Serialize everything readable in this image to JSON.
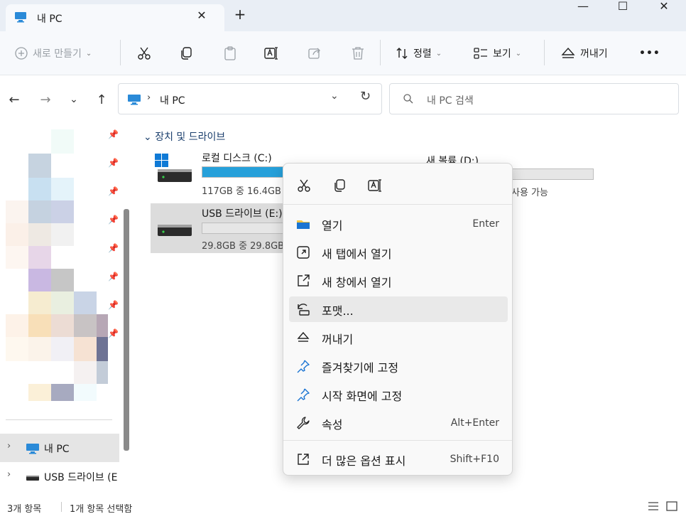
{
  "window": {
    "tab_title": "내 PC",
    "tab_close": "✕",
    "new_tab": "+",
    "minimize": "—",
    "maximize": "☐",
    "close": "✕"
  },
  "toolbar": {
    "new_label": "새로 만들기",
    "sort_label": "정렬",
    "view_label": "보기",
    "eject_label": "꺼내기",
    "more": "•••"
  },
  "address": {
    "crumb_separator": "›",
    "crumb": "내 PC",
    "dropdown": "⌄",
    "refresh": "↻",
    "search_placeholder": "내 PC 검색"
  },
  "nav": {
    "back": "←",
    "forward": "→",
    "recent": "⌄",
    "up": "↑",
    "items": [
      {
        "label": "내 PC",
        "expander": "›"
      },
      {
        "label": "USB 드라이브 (E",
        "expander": "›"
      }
    ]
  },
  "content": {
    "group_header": "장치 및 드라이브",
    "group_chevron": "⌄",
    "drives": [
      {
        "name": "로컬 디스크 (C:)",
        "space": "117GB 중 16.4GB",
        "used_fraction": 0.86
      },
      {
        "name": "USB 드라이브 (E:)",
        "space": "29.8GB 중 29.8GB",
        "used_fraction": 0.0
      },
      {
        "name": "새 볼륨 (D:)",
        "space": "사용 가능",
        "used_fraction": 0.0
      }
    ]
  },
  "status": {
    "count": "3개 항목",
    "selected": "1개 항목 선택함"
  },
  "context_menu": {
    "items": [
      {
        "label": "열기",
        "shortcut": "Enter",
        "icon": "folder-icon"
      },
      {
        "label": "새 탭에서 열기",
        "shortcut": "",
        "icon": "open-in-tab-icon"
      },
      {
        "label": "새 창에서 열기",
        "shortcut": "",
        "icon": "open-in-window-icon"
      },
      {
        "label": "포맷...",
        "shortcut": "",
        "icon": "format-icon"
      },
      {
        "label": "꺼내기",
        "shortcut": "",
        "icon": "eject-icon"
      },
      {
        "label": "즐겨찾기에 고정",
        "shortcut": "",
        "icon": "pin-icon"
      },
      {
        "label": "시작 화면에 고정",
        "shortcut": "",
        "icon": "pin-icon"
      },
      {
        "label": "속성",
        "shortcut": "Alt+Enter",
        "icon": "wrench-icon"
      },
      {
        "label": "더 많은 옵션 표시",
        "shortcut": "Shift+F10",
        "icon": "more-options-icon"
      }
    ]
  },
  "colors": {
    "accent": "#26a0da",
    "titlebar": "#e9eef5",
    "selection": "#dcdcdc"
  }
}
